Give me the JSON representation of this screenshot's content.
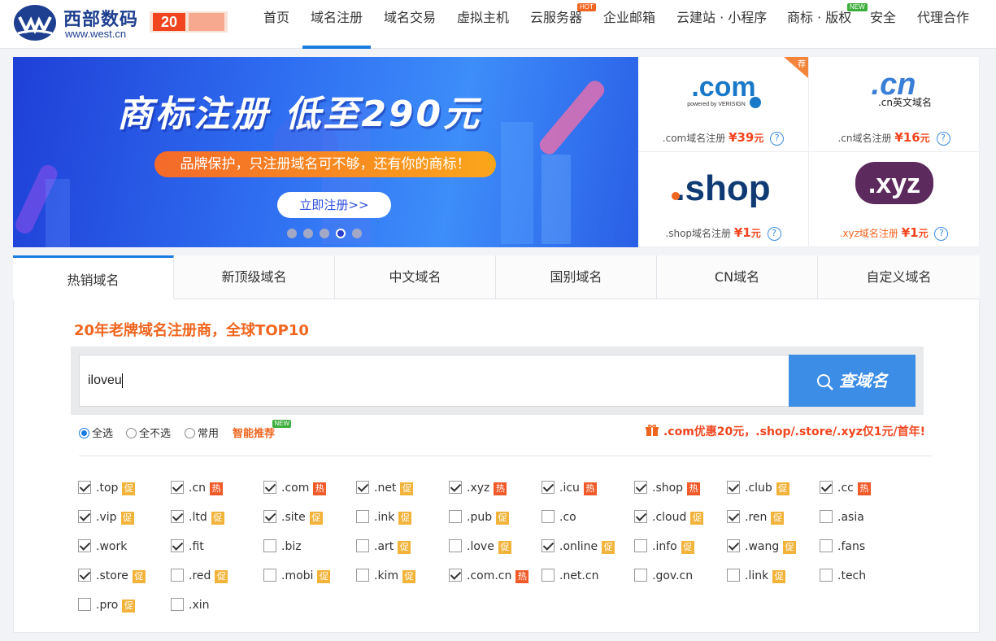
{
  "header": {
    "brand_cn": "西部数码",
    "brand_url": "www.west.cn",
    "anniversary": "20",
    "nav": [
      {
        "label": "首页"
      },
      {
        "label": "域名注册",
        "active": true
      },
      {
        "label": "域名交易"
      },
      {
        "label": "虚拟主机"
      },
      {
        "label": "云服务器",
        "badge": "HOT"
      },
      {
        "label": "企业邮箱"
      },
      {
        "label": "云建站 · 小程序"
      },
      {
        "label": "商标 · 版权",
        "badge": "NEW"
      },
      {
        "label": "安全"
      },
      {
        "label": "代理合作"
      }
    ]
  },
  "banner": {
    "title": "商标注册 低至290元",
    "subtitle": "品牌保护，只注册域名可不够，还有你的商标！",
    "button": "立即注册>>",
    "dots": 5,
    "active_dot": 4
  },
  "tld_cards": [
    {
      "logo": ".com",
      "logo_sub": "powered by VERISIGN",
      "name": ".com域名注册",
      "price": "¥39",
      "unit": "元",
      "ribbon": "荐"
    },
    {
      "logo": ".cn",
      "logo_sub": ".cn英文域名",
      "name": ".cn域名注册",
      "price": "¥16",
      "unit": "元"
    },
    {
      "logo": ".shop",
      "name": ".shop域名注册",
      "price": "¥1",
      "unit": "元"
    },
    {
      "logo": ".xyz",
      "name": ".xyz域名注册",
      "price": "¥1",
      "unit": "元"
    }
  ],
  "help_mark": "?",
  "tabs": [
    {
      "label": "热销域名",
      "active": true
    },
    {
      "label": "新顶级域名"
    },
    {
      "label": "中文域名"
    },
    {
      "label": "国别域名"
    },
    {
      "label": "CN域名"
    },
    {
      "label": "自定义域名"
    }
  ],
  "slogan": "20年老牌域名注册商，全球TOP10",
  "search": {
    "value": "iloveu",
    "button": "查域名"
  },
  "options": {
    "select_all": "全选",
    "select_none": "全不选",
    "common": "常用",
    "smart": "智能推荐",
    "smart_badge": "NEW",
    "selected": "select_all"
  },
  "promo": ".com优惠20元，.shop/.store/.xyz仅1元/首年!",
  "tag_labels": {
    "cu": "促",
    "re": "热"
  },
  "tlds": [
    {
      "name": ".top",
      "checked": true,
      "tag": "cu"
    },
    {
      "name": ".cn",
      "checked": true,
      "tag": "re"
    },
    {
      "name": ".com",
      "checked": true,
      "tag": "re"
    },
    {
      "name": ".net",
      "checked": true,
      "tag": "cu"
    },
    {
      "name": ".xyz",
      "checked": true,
      "tag": "re"
    },
    {
      "name": ".icu",
      "checked": true,
      "tag": "re"
    },
    {
      "name": ".shop",
      "checked": true,
      "tag": "re"
    },
    {
      "name": ".club",
      "checked": true,
      "tag": "cu"
    },
    {
      "name": ".cc",
      "checked": true,
      "tag": "re"
    },
    {
      "name": ".vip",
      "checked": true,
      "tag": "cu"
    },
    {
      "name": ".ltd",
      "checked": true,
      "tag": "cu"
    },
    {
      "name": ".site",
      "checked": true,
      "tag": "cu"
    },
    {
      "name": ".ink",
      "checked": false,
      "tag": "cu"
    },
    {
      "name": ".pub",
      "checked": false,
      "tag": "cu"
    },
    {
      "name": ".co",
      "checked": false,
      "tag": ""
    },
    {
      "name": ".cloud",
      "checked": true,
      "tag": "cu"
    },
    {
      "name": ".ren",
      "checked": true,
      "tag": "cu"
    },
    {
      "name": ".asia",
      "checked": false,
      "tag": ""
    },
    {
      "name": ".work",
      "checked": true,
      "tag": ""
    },
    {
      "name": ".fit",
      "checked": true,
      "tag": ""
    },
    {
      "name": ".biz",
      "checked": false,
      "tag": ""
    },
    {
      "name": ".art",
      "checked": false,
      "tag": "cu"
    },
    {
      "name": ".love",
      "checked": false,
      "tag": "cu"
    },
    {
      "name": ".online",
      "checked": true,
      "tag": "cu"
    },
    {
      "name": ".info",
      "checked": false,
      "tag": "cu"
    },
    {
      "name": ".wang",
      "checked": true,
      "tag": "cu"
    },
    {
      "name": ".fans",
      "checked": false,
      "tag": ""
    },
    {
      "name": ".store",
      "checked": true,
      "tag": "cu"
    },
    {
      "name": ".red",
      "checked": false,
      "tag": "cu"
    },
    {
      "name": ".mobi",
      "checked": false,
      "tag": "cu"
    },
    {
      "name": ".kim",
      "checked": false,
      "tag": "cu"
    },
    {
      "name": ".com.cn",
      "checked": true,
      "tag": "re"
    },
    {
      "name": ".net.cn",
      "checked": false,
      "tag": ""
    },
    {
      "name": ".gov.cn",
      "checked": false,
      "tag": ""
    },
    {
      "name": ".link",
      "checked": false,
      "tag": "cu"
    },
    {
      "name": ".tech",
      "checked": false,
      "tag": ""
    },
    {
      "name": ".pro",
      "checked": false,
      "tag": "cu"
    },
    {
      "name": ".xin",
      "checked": false,
      "tag": ""
    }
  ],
  "colors": {
    "accent": "#1a7be0",
    "orange": "#f0651f",
    "price": "#f0451e",
    "tag_cu": "#f2b33a",
    "tag_re": "#f05a28"
  }
}
